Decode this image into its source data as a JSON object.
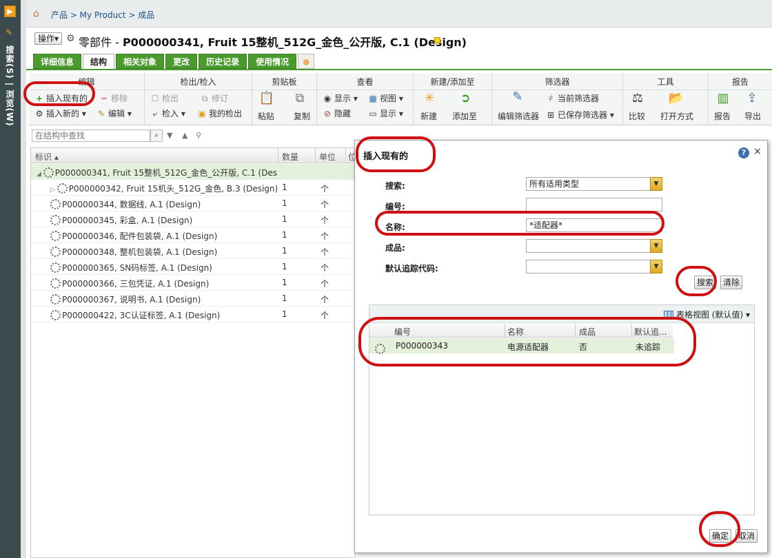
{
  "leftnav": {
    "vertical_label": "搜索(S) | 浏览(W)"
  },
  "breadcrumb": {
    "text": "产品 > My Product > 成品"
  },
  "header": {
    "ops_label": "操作▾",
    "object_type": "零部件 - ",
    "object_name": "P000000341, Fruit 15整机_512G_金色_公开版, C.1 (Design)"
  },
  "tabs": [
    {
      "label": "详细信息",
      "active": false
    },
    {
      "label": "结构",
      "active": true
    },
    {
      "label": "相关对象",
      "active": false
    },
    {
      "label": "更改",
      "active": false
    },
    {
      "label": "历史记录",
      "active": false
    },
    {
      "label": "使用情况",
      "active": false
    }
  ],
  "ribbon": {
    "edit": {
      "title": "编辑",
      "insert_existing": "插入现有的",
      "remove": "移除",
      "insert_new": "插入新的",
      "edit": "编辑"
    },
    "checkout": {
      "title": "检出/检入",
      "checkout": "检出",
      "revise": "修订",
      "checkin": "检入",
      "my_checkouts": "我的检出"
    },
    "clipboard": {
      "title": "剪贴板",
      "paste": "粘贴",
      "copy": "复制"
    },
    "view": {
      "title": "查看",
      "show": "显示",
      "view": "视图",
      "hide": "隐藏",
      "display": "显示"
    },
    "create": {
      "title": "新建/添加至",
      "new": "新建",
      "add_to": "添加至"
    },
    "filter": {
      "title": "筛选器",
      "current_filter": "当前筛选器",
      "edit_filter": "编辑筛选器",
      "saved_filter": "已保存筛选器"
    },
    "tools": {
      "title": "工具",
      "compare": "比较",
      "open_with": "打开方式"
    },
    "report": {
      "title": "报告",
      "report": "报告",
      "export": "导出"
    }
  },
  "tree": {
    "search_placeholder": "在结构中查找",
    "columns": {
      "id": "标识 ▴",
      "qty": "数量",
      "unit": "单位",
      "pos": "位"
    },
    "rows": [
      {
        "label": "P000000341, Fruit 15整机_512G_金色_公开版, C.1 (Design)",
        "qty": "",
        "unit": "",
        "level": 0
      },
      {
        "label": "P000000342, Fruit 15机头_512G_金色, B.3 (Design)",
        "qty": "1",
        "unit": "个",
        "level": 1
      },
      {
        "label": "P000000344, 数据线, A.1 (Design)",
        "qty": "1",
        "unit": "个",
        "level": 1
      },
      {
        "label": "P000000345, 彩盒, A.1 (Design)",
        "qty": "1",
        "unit": "个",
        "level": 1
      },
      {
        "label": "P000000346, 配件包装袋, A.1 (Design)",
        "qty": "1",
        "unit": "个",
        "level": 1
      },
      {
        "label": "P000000348, 整机包装袋, A.1 (Design)",
        "qty": "1",
        "unit": "个",
        "level": 1
      },
      {
        "label": "P000000365, SN码标签, A.1 (Design)",
        "qty": "1",
        "unit": "个",
        "level": 1
      },
      {
        "label": "P000000366, 三包凭证, A.1 (Design)",
        "qty": "1",
        "unit": "个",
        "level": 1
      },
      {
        "label": "P000000367, 说明书, A.1 (Design)",
        "qty": "1",
        "unit": "个",
        "level": 1
      },
      {
        "label": "P000000422, 3C认证标签, A.1 (Design)",
        "qty": "1",
        "unit": "个",
        "level": 1
      }
    ]
  },
  "dialog": {
    "title": "插入现有的",
    "fields": {
      "search_label": "搜索:",
      "search_value": "所有适用类型",
      "number_label": "编号:",
      "number_value": "",
      "name_label": "名称:",
      "name_value": "*适配器*",
      "product_label": "成品:",
      "product_value": "",
      "trace_label": "默认追踪代码:",
      "trace_value": ""
    },
    "search_button": "搜索",
    "clear_button": "清除",
    "grid_view_label": "表格视图 (默认值) ▾",
    "result_columns": {
      "number": "编号",
      "name": "名称",
      "product": "成品",
      "trace": "默认追..."
    },
    "results": [
      {
        "number": "P000000343",
        "name": "电源适配器",
        "product": "否",
        "trace": "未追踪"
      }
    ],
    "ok_button": "确定",
    "cancel_button": "取消"
  },
  "colors": {
    "accent_green": "#4a9a2e",
    "annotation_red": "#d01010",
    "selected_row": "#e3f0da"
  }
}
